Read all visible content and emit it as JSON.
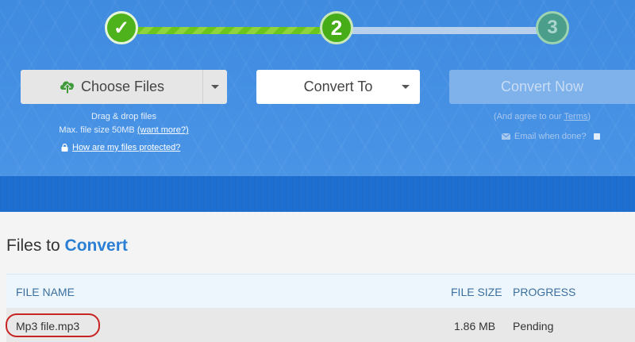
{
  "steps": [
    {
      "label": "✓",
      "state": "done"
    },
    {
      "label": "2",
      "state": "active"
    },
    {
      "label": "3",
      "state": "pending"
    }
  ],
  "choose_files": {
    "label": "Choose Files",
    "icon": "cloud-upload-icon",
    "drag_text": "Drag & drop files",
    "max_size_prefix": "Max. file size 50MB ",
    "want_more_link": "(want more?)",
    "protected_link": "How are my files protected?"
  },
  "convert_to": {
    "label": "Convert To"
  },
  "convert_now": {
    "label": "Convert Now",
    "agree_prefix": "(And agree to our ",
    "terms_link": "Terms",
    "agree_suffix": ")",
    "email_label": "Email when done?"
  },
  "files": {
    "title_plain": "Files to ",
    "title_accent": "Convert",
    "columns": {
      "name": "FILE NAME",
      "size": "FILE SIZE",
      "progress": "PROGRESS"
    },
    "rows": [
      {
        "name": "Mp3 file.mp3",
        "size": "1.86 MB",
        "progress": "Pending"
      }
    ]
  },
  "colors": {
    "hero_blue": "#3f8be0",
    "progress_green": "#6cc51d",
    "accent_blue": "#2a7fd4",
    "annotation_red": "#c82323"
  }
}
